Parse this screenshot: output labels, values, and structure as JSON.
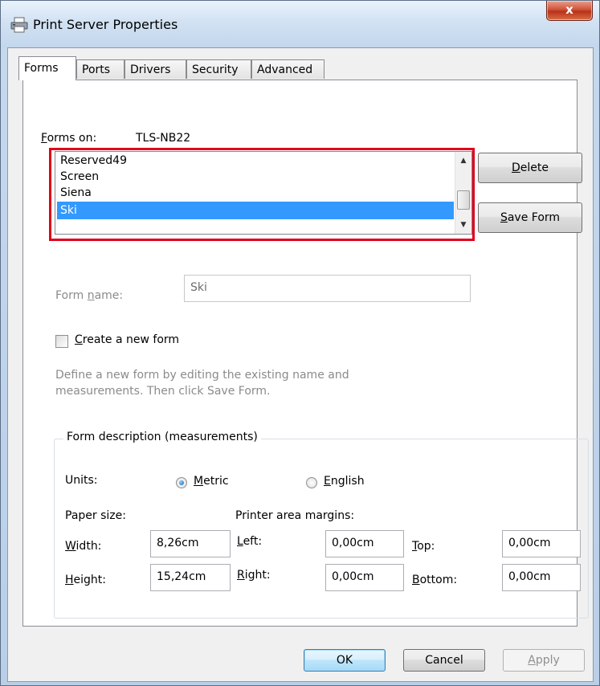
{
  "window": {
    "title": "Print Server Properties",
    "close_label": "x"
  },
  "tabs": [
    {
      "label": "Forms",
      "active": true
    },
    {
      "label": "Ports",
      "active": false
    },
    {
      "label": "Drivers",
      "active": false
    },
    {
      "label": "Security",
      "active": false
    },
    {
      "label": "Advanced",
      "active": false
    }
  ],
  "forms_on": {
    "label_prefix": "F",
    "label_rest": "orms on:",
    "server": "TLS-NB22"
  },
  "forms_list": {
    "items": [
      "Reserved49",
      "Screen",
      "Siena",
      "Ski"
    ],
    "selected": "Ski"
  },
  "buttons": {
    "delete_u": "D",
    "delete_rest": "elete",
    "save_u": "S",
    "save_rest": "ave Form",
    "ok": "OK",
    "cancel": "Cancel",
    "apply_u": "A",
    "apply_rest": "pply"
  },
  "form_name": {
    "label_a": "Form ",
    "label_u": "n",
    "label_b": "ame:",
    "value": "Ski"
  },
  "create_new_form": {
    "label_u": "C",
    "label_rest": "reate a new form",
    "checked": false
  },
  "description": "Define a new form by editing the existing name and measurements. Then click Save Form.",
  "measurements": {
    "group_title": "Form description (measurements)",
    "units_label": "Units:",
    "metric_u": "M",
    "metric_rest": "etric",
    "english_u": "E",
    "english_rest": "nglish",
    "selected_unit": "Metric",
    "paper_size_label": "Paper size:",
    "margins_label": "Printer area margins:",
    "width_u": "W",
    "width_rest": "idth:",
    "width_value": "8,26cm",
    "height_u": "H",
    "height_rest": "eight:",
    "height_value": "15,24cm",
    "left_u": "L",
    "left_rest": "eft:",
    "left_value": "0,00cm",
    "right_u": "R",
    "right_rest": "ight:",
    "right_value": "0,00cm",
    "top_u": "T",
    "top_rest": "op:",
    "top_value": "0,00cm",
    "bottom_u": "B",
    "bottom_rest": "ottom:",
    "bottom_value": "0,00cm"
  },
  "colors": {
    "highlight_border": "#e1001a",
    "selection": "#3399ff",
    "close_button": "#c94a2e"
  }
}
